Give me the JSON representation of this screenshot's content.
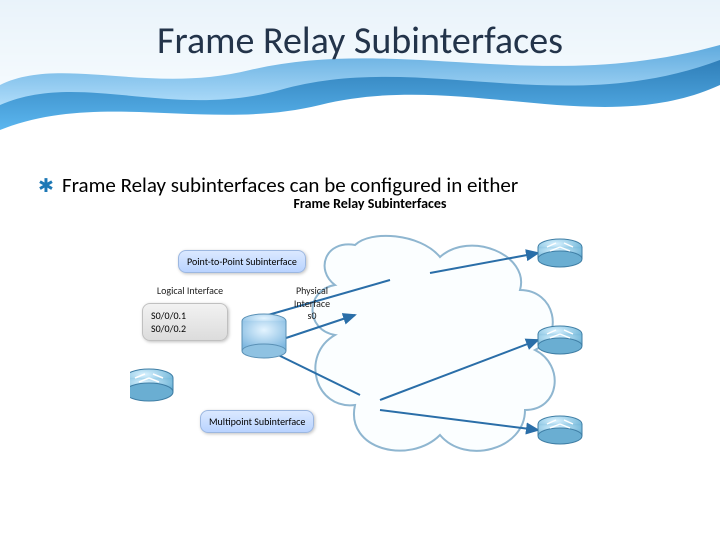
{
  "slide": {
    "title": "Frame Relay Subinterfaces",
    "bullet_text": "Frame Relay subinterfaces can be configured in either"
  },
  "diagram": {
    "heading": "Frame Relay Subinterfaces",
    "ptp_label": "Point-to-Point Subinterface",
    "logical_label": "Logical Interface",
    "physical_label": "Physical\nInterface\ns0",
    "sub1": "S0/0/0.1",
    "sub2": "S0/0/0.2",
    "multipoint_label": "Multipoint Subinterface"
  },
  "icons": {
    "router": "router-icon",
    "cloud": "cloud-shape",
    "cylinder": "cylinder-icon"
  }
}
